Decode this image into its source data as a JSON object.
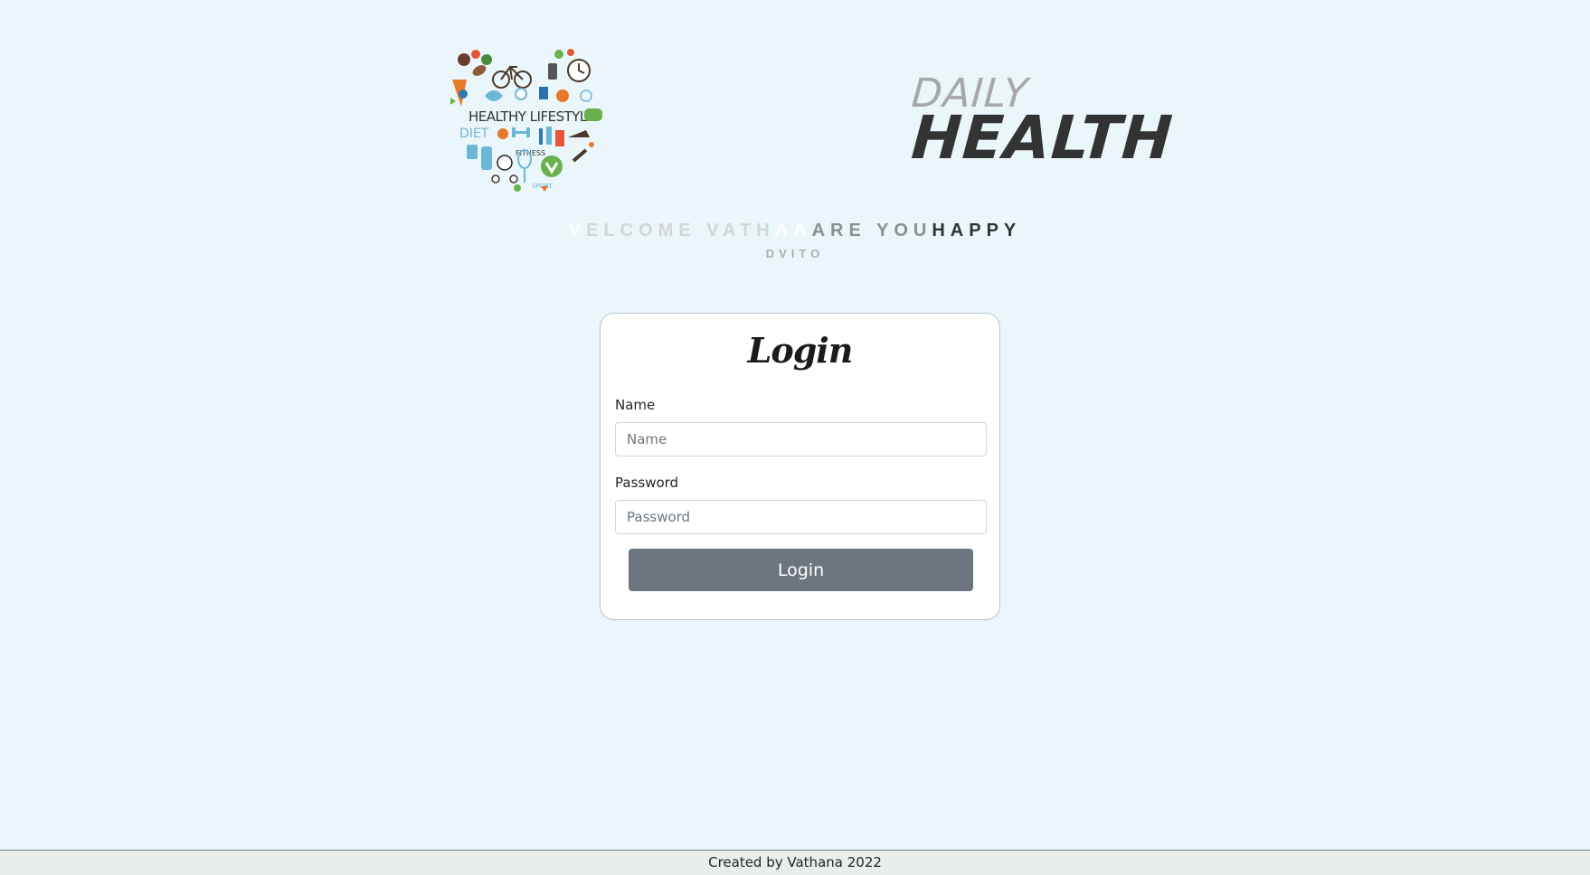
{
  "header": {
    "logo_text_healthy_lifestyle": "HEALTHY LIFESTYLE",
    "logo_text_diet": "DIET",
    "logo_text_fitness": "FITNESS",
    "logo_text_sport": "SPORT",
    "brand_daily": "DAILY",
    "brand_health": "HEALTH",
    "welcome_parts": [
      "V",
      "ELCOME VATH",
      "A",
      "A ",
      "ARE YOU ",
      "HAPPY"
    ],
    "subtitle": "DVITO"
  },
  "login": {
    "title": "Login",
    "name_label": "Name",
    "name_placeholder": "Name",
    "name_value": "",
    "password_label": "Password",
    "password_placeholder": "Password",
    "password_value": "",
    "submit_label": "Login"
  },
  "footer": {
    "text": "Created by Vathana 2022"
  },
  "colors": {
    "page_background": "#ebf6fb",
    "button": "#6c757d",
    "brand_daily": "#a8a8a8",
    "brand_health": "#333333"
  },
  "icons": [
    "heart-lifestyle-logo",
    "bicycle-icon",
    "ball-icon",
    "dumbbell-icon",
    "clock-icon",
    "shoe-icon",
    "water-bottle-icon",
    "tennis-racket-icon",
    "carrot-icon",
    "fish-icon"
  ]
}
